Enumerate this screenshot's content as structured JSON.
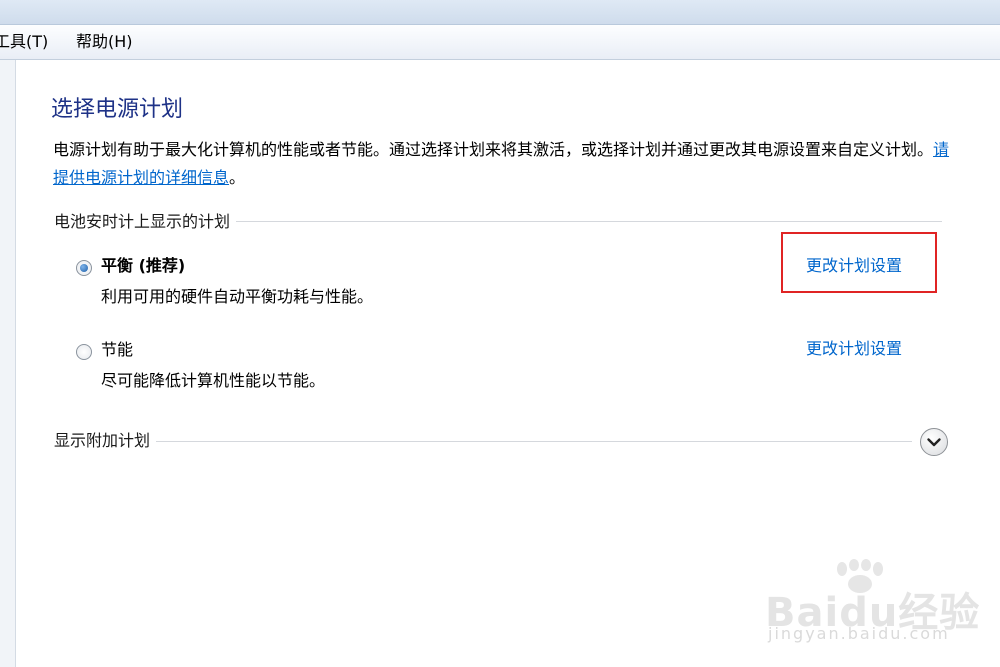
{
  "menubar": {
    "tools": "工具(T)",
    "help": "帮助(H)"
  },
  "page": {
    "title": "选择电源计划",
    "description": "电源计划有助于最大化计算机的性能或者节能。通过选择计划来将其激活，或选择计划并通过更改其电源设置来自定义计划。",
    "info_link": "请提供电源计划的详细信息",
    "info_suffix": "。"
  },
  "battery_section": {
    "label": "电池安时计上显示的计划",
    "plans": [
      {
        "name": "平衡 (推荐)",
        "description": "利用可用的硬件自动平衡功耗与性能。",
        "selected": true,
        "change_link": "更改计划设置"
      },
      {
        "name": "节能",
        "description": "尽可能降低计算机性能以节能。",
        "selected": false,
        "change_link": "更改计划设置"
      }
    ]
  },
  "additional_section": {
    "label": "显示附加计划",
    "expand_icon": "chevron-down-icon"
  },
  "highlight": {
    "color": "#e02424"
  },
  "watermark": {
    "brand": "Baidu经验",
    "url": "jingyan.baidu.com"
  }
}
